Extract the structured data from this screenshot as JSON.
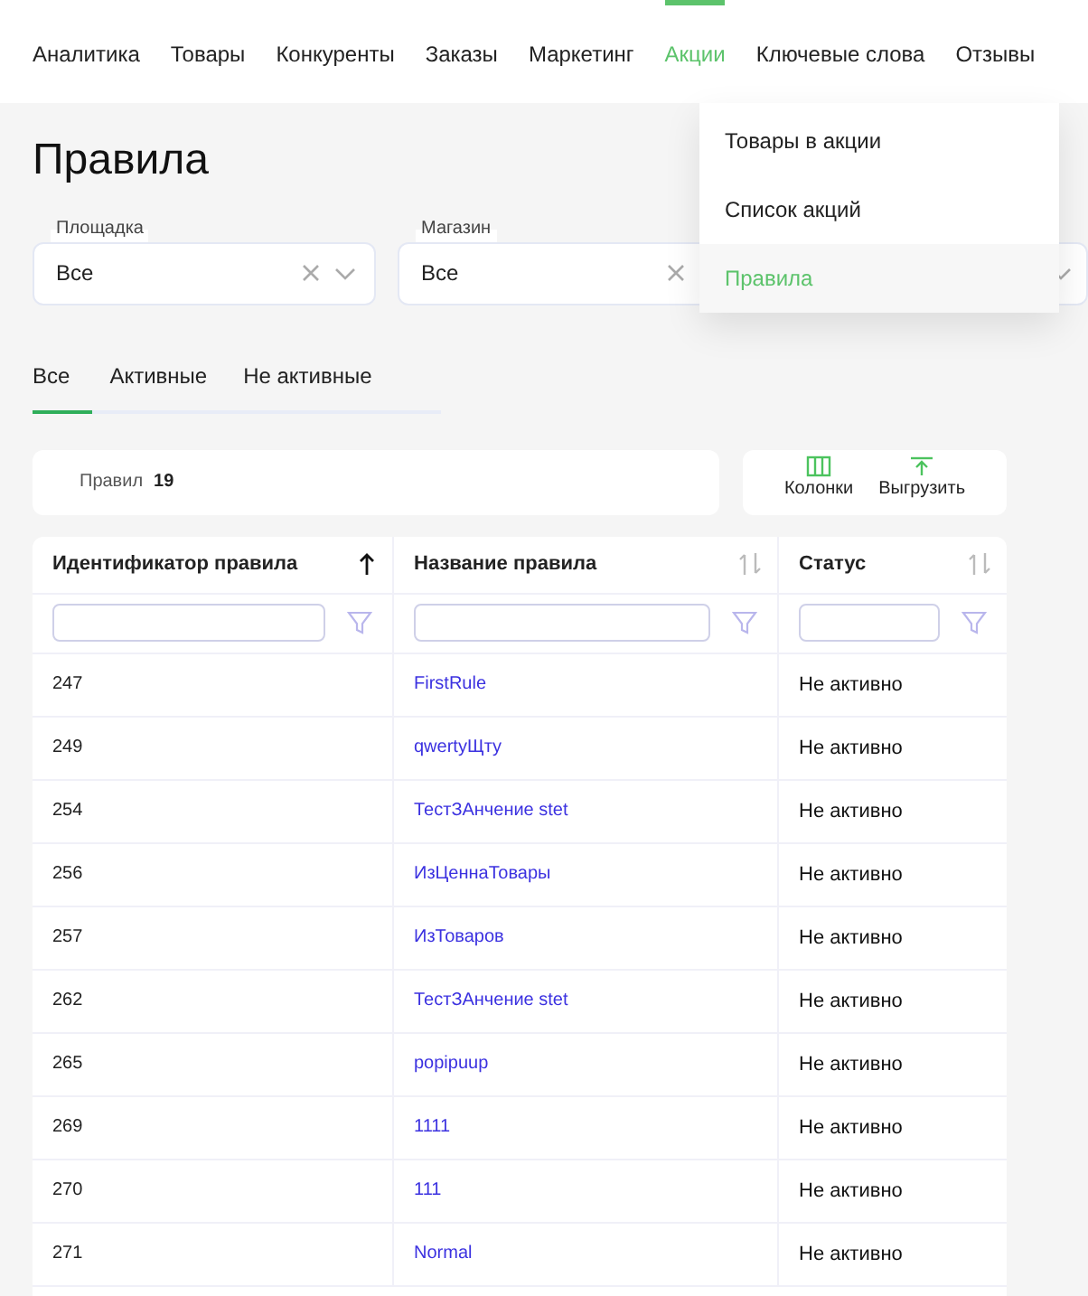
{
  "nav": {
    "items": [
      {
        "label": "Аналитика",
        "selected": false
      },
      {
        "label": "Товары",
        "selected": false
      },
      {
        "label": "Конкуренты",
        "selected": false
      },
      {
        "label": "Заказы",
        "selected": false
      },
      {
        "label": "Маркетинг",
        "selected": false
      },
      {
        "label": "Акции",
        "selected": true
      },
      {
        "label": "Ключевые слова",
        "selected": false
      },
      {
        "label": "Отзывы",
        "selected": false
      }
    ]
  },
  "dropdown": {
    "items": [
      {
        "label": "Товары в акции",
        "selected": false
      },
      {
        "label": "Список акций",
        "selected": false
      },
      {
        "label": "Правила",
        "selected": true
      }
    ]
  },
  "title": "Правила",
  "filters": [
    {
      "label": "Площадка",
      "value": "Все"
    },
    {
      "label": "Магазин",
      "value": "Все"
    }
  ],
  "tabs": [
    {
      "label": "Все",
      "selected": true
    },
    {
      "label": "Активные",
      "selected": false
    },
    {
      "label": "Не активные",
      "selected": false
    }
  ],
  "summary": {
    "label": "Правил",
    "count": "19"
  },
  "toolbar": [
    {
      "label": "Колонки",
      "kind": "columns"
    },
    {
      "label": "Выгрузить",
      "kind": "export"
    }
  ],
  "table": {
    "columns": [
      {
        "label": "Идентификатор правила",
        "sorted": true
      },
      {
        "label": "Название правила",
        "sorted": false
      },
      {
        "label": "Статус",
        "sorted": false
      }
    ],
    "rows": [
      {
        "id": "247",
        "name": "FirstRule",
        "status": "Не активно"
      },
      {
        "id": "249",
        "name": "qwertyЩту",
        "status": "Не активно"
      },
      {
        "id": "254",
        "name": "ТестЗАнчение stet",
        "status": "Не активно"
      },
      {
        "id": "256",
        "name": "ИзЦеннаТовары",
        "status": "Не активно"
      },
      {
        "id": "257",
        "name": "ИзТоваров",
        "status": "Не активно"
      },
      {
        "id": "262",
        "name": "ТестЗАнчение stet",
        "status": "Не активно"
      },
      {
        "id": "265",
        "name": "popipuup",
        "status": "Не активно"
      },
      {
        "id": "269",
        "name": "1111",
        "status": "Не активно"
      },
      {
        "id": "270",
        "name": "111",
        "status": "Не активно"
      },
      {
        "id": "271",
        "name": "Normal",
        "status": "Не активно"
      }
    ]
  }
}
